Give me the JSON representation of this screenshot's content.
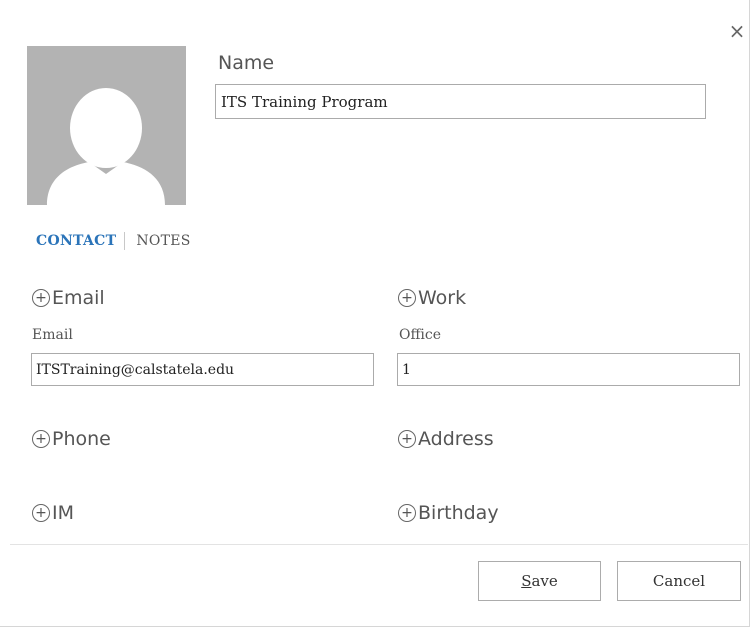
{
  "dialog": {
    "close_glyph": "×"
  },
  "name": {
    "label": "Name",
    "value": "ITS Training Program"
  },
  "tabs": [
    {
      "label": "CONTACT",
      "active": true
    },
    {
      "label": "NOTES",
      "active": false
    }
  ],
  "sections": {
    "email": {
      "label": "Email",
      "field_label": "Email",
      "value": "ITSTraining@calstatela.edu"
    },
    "work": {
      "label": "Work",
      "field_label": "Office",
      "value": "1"
    },
    "phone": {
      "label": "Phone"
    },
    "address": {
      "label": "Address"
    },
    "im": {
      "label": "IM"
    },
    "birthday": {
      "label": "Birthday"
    }
  },
  "buttons": {
    "save_mnemonic": "S",
    "save_rest": "ave",
    "cancel": "Cancel"
  },
  "icons": {
    "add": "add-circle-icon",
    "close": "close-icon",
    "avatar": "person-placeholder-icon"
  },
  "colors": {
    "accent": "#2b74b9",
    "avatar_bg": "#b3b3b3"
  }
}
